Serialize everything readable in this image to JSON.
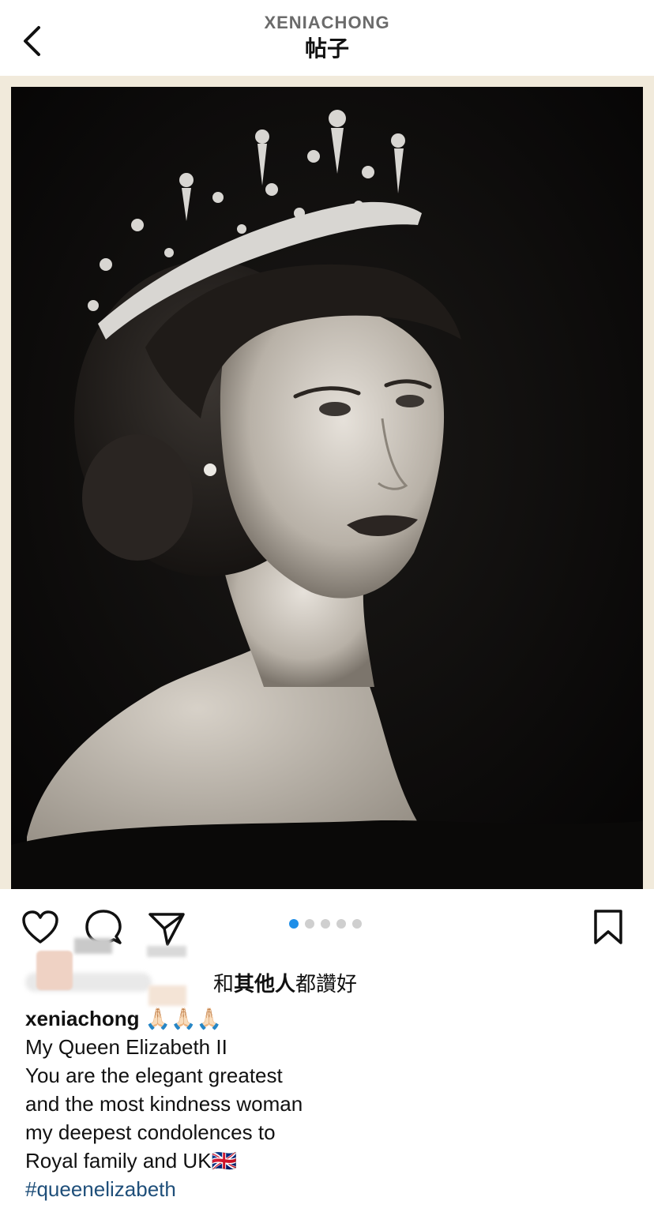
{
  "header": {
    "username": "XENIACHONG",
    "page_title": "帖子",
    "back_icon": "chevron-left-icon"
  },
  "post": {
    "image_alt": "black-and-white portrait of Queen Elizabeth II wearing a diamond tiara",
    "carousel": {
      "total": 5,
      "active_index": 0
    },
    "actions": [
      "heart-icon",
      "comment-icon",
      "share-icon",
      "bookmark-icon"
    ],
    "likes_prefix": "和",
    "likes_bold": "其他人",
    "likes_suffix": "都讚好",
    "caption": {
      "username": "xeniachong",
      "emoji": "🙏🏻🙏🏻🙏🏻",
      "lines": [
        "My Queen Elizabeth II",
        "You are the elegant greatest",
        "and the most kindness woman",
        "my deepest condolences to",
        "Royal family and UK🇬🇧"
      ],
      "hashtag": "#queenelizabeth"
    }
  },
  "colors": {
    "active_dot": "#1f8fe8",
    "inactive_dot": "#cfcfcf",
    "hashtag": "#1f4f7a",
    "frame": "#f1eadb"
  }
}
